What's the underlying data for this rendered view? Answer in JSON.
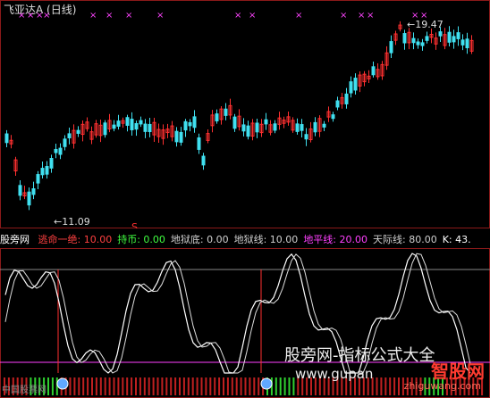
{
  "header": {
    "title": "飞亚达A (日线)"
  },
  "price_chart": {
    "high_label": "19.47",
    "low_label": "11.09",
    "signal_marker": "S",
    "colors": {
      "up": "#ff3030",
      "down": "#40e0f0",
      "marker": "#ff44ff"
    }
  },
  "indicator": {
    "name": "股旁网",
    "items": [
      {
        "label": "逃命一绝:",
        "value": "10.00",
        "color": "#ff4040"
      },
      {
        "label": "持币:",
        "value": "0.00",
        "color": "#40ff40"
      },
      {
        "label": "地狱底:",
        "value": "0.00",
        "color": "#d0d0d0"
      },
      {
        "label": "地狱线:",
        "value": "10.00",
        "color": "#d0d0d0"
      },
      {
        "label": "地平线:",
        "value": "20.00",
        "color": "#ff40ff"
      },
      {
        "label": "天际线:",
        "value": "80.00",
        "color": "#d0d0d0"
      },
      {
        "label": "K:",
        "value": "43.",
        "color": "#ffffff"
      }
    ]
  },
  "watermark": {
    "line1": "股旁网-指标公式大全",
    "line2": "www.gupan",
    "logo": "智股网",
    "logo_url": "zhiguwang.com"
  },
  "footer": {
    "note": "中国股票网"
  }
}
